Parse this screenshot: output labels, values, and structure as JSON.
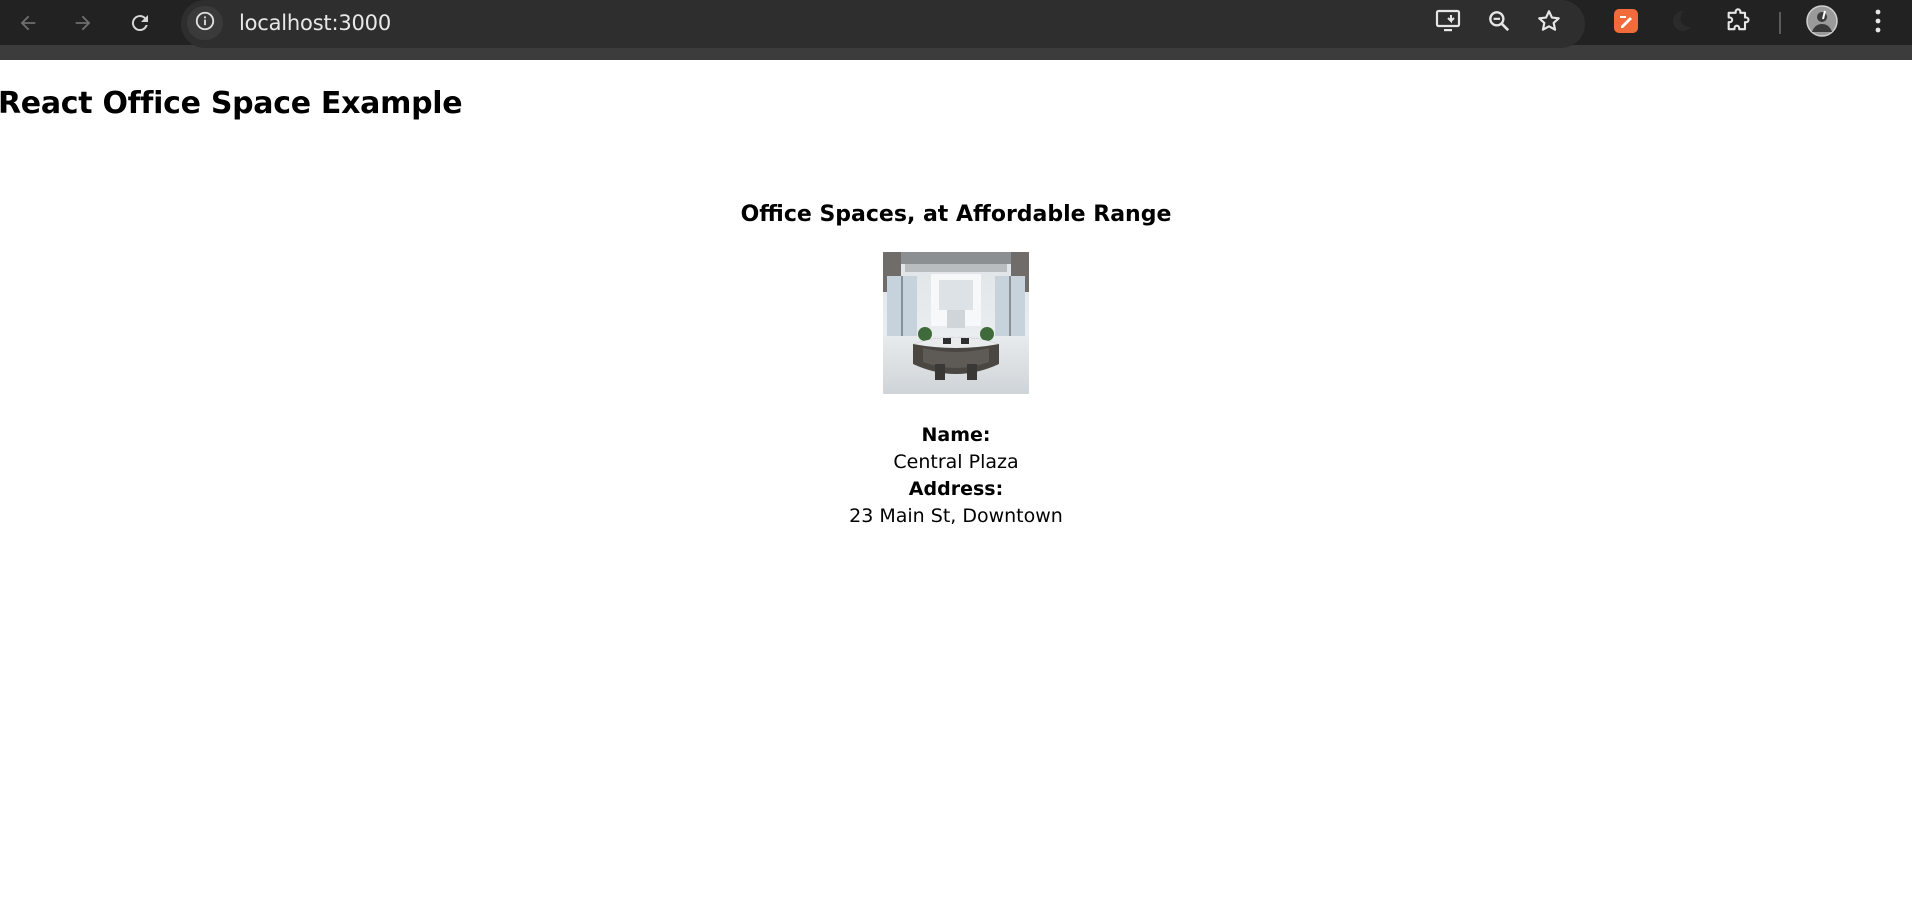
{
  "browser": {
    "url": "localhost:3000",
    "icons": {
      "back": "arrow-left-icon",
      "forward": "arrow-right-icon",
      "reload": "reload-icon",
      "site_info": "info-icon",
      "install": "install-app-icon",
      "zoom": "zoom-icon",
      "bookmark": "star-icon",
      "extension1": "orange-extension-icon",
      "extension2": "dark-extension-icon",
      "extensions_menu": "puzzle-icon",
      "profile": "avatar",
      "menu": "more-vert-icon"
    },
    "colors": {
      "toolbar_bg": "#222222",
      "omnibox_bg": "#2e2e2e",
      "extension_accent": "#f26b3a"
    }
  },
  "page": {
    "heading": "React Office Space Example",
    "section_title": "Office Spaces, at Affordable Range",
    "office": {
      "image_alt": "office lobby with circular reception desk",
      "name_label": "Name:",
      "name": "Central Plaza",
      "address_label": "Address:",
      "address": "23 Main St, Downtown"
    }
  }
}
